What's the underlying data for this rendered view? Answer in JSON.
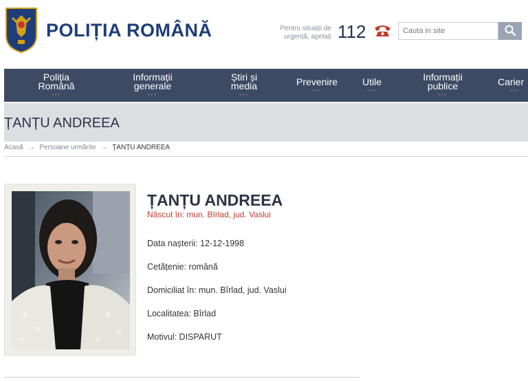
{
  "header": {
    "site_title": "POLIȚIA ROMÂNĂ",
    "emergency_text_line1": "Pentru situații de",
    "emergency_text_line2": "urgență, apelați",
    "emergency_number": "112",
    "search_placeholder": "Cauta in site"
  },
  "nav": {
    "items": [
      {
        "line1": "Poliția",
        "line2": "Română",
        "dots": "•••"
      },
      {
        "line1": "Informații",
        "line2": "generale",
        "dots": "•••"
      },
      {
        "line1": "Știri și",
        "line2": "media",
        "dots": "•••"
      },
      {
        "line1": "Prevenire",
        "line2": "",
        "dots": "•••"
      },
      {
        "line1": "Utile",
        "line2": "",
        "dots": "•••"
      },
      {
        "line1": "Informații",
        "line2": "publice",
        "dots": "•••"
      },
      {
        "line1": "Carier",
        "line2": "",
        "dots": "•••"
      }
    ]
  },
  "page": {
    "heading": "ȚANȚU ANDREEA"
  },
  "breadcrumb": {
    "home": "Acasă",
    "section": "Persoane urmărite",
    "current": "ȚANȚU ANDREEA",
    "separator": "→"
  },
  "person": {
    "name": "ȚANȚU ANDREEA",
    "born_in": "Născut în: mun. Bîrlad, jud. Vaslui",
    "birth_date": "Data nașterii: 12-12-1998",
    "citizenship": "Cetățenie: română",
    "residence": "Domiciliat în: mun. Bîrlad, jud. Vaslui",
    "locality": "Localitatea: Bîrlad",
    "reason": "Motivul: DISPARUT"
  },
  "colors": {
    "brand_blue": "#1f3d7a",
    "nav_bg": "#3c4a63",
    "title_band_bg": "#dcdee2",
    "accent_red": "#c0392b"
  },
  "icons": {
    "logo": "coat-of-arms-icon",
    "phone": "phone-icon",
    "search": "search-icon"
  }
}
